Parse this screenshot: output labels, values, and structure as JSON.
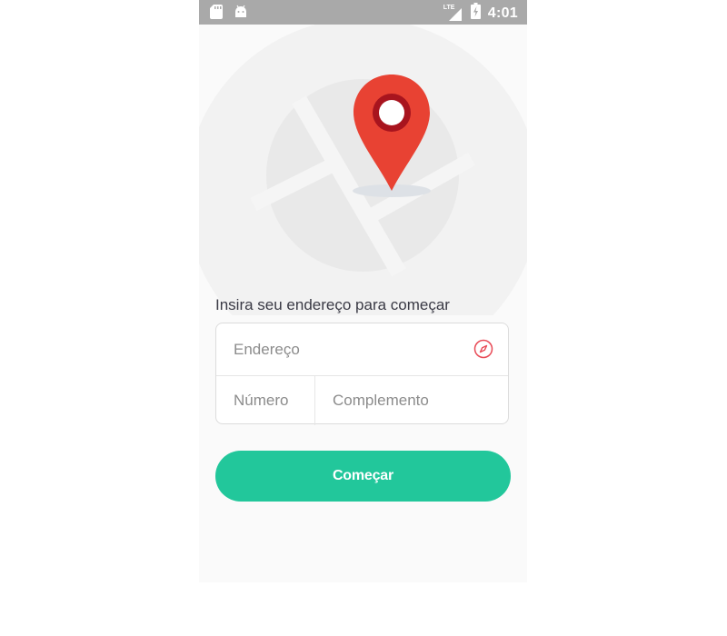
{
  "status_bar": {
    "time": "4:01",
    "network_label": "LTE",
    "icons": [
      "sd-card-icon",
      "android-icon",
      "signal-icon",
      "battery-charging-icon"
    ]
  },
  "illustration": {
    "icons": [
      "map-icon",
      "location-pin-icon"
    ],
    "pin_color": "#e84233",
    "pin_ring_color": "#a8141e"
  },
  "form": {
    "prompt": "Insira seu endereço para começar",
    "address_placeholder": "Endereço",
    "number_placeholder": "Número",
    "complement_placeholder": "Complemento",
    "locate_icon": "compass-icon",
    "locate_icon_color": "#e84a56"
  },
  "actions": {
    "start_label": "Começar",
    "start_color": "#22c79b"
  }
}
